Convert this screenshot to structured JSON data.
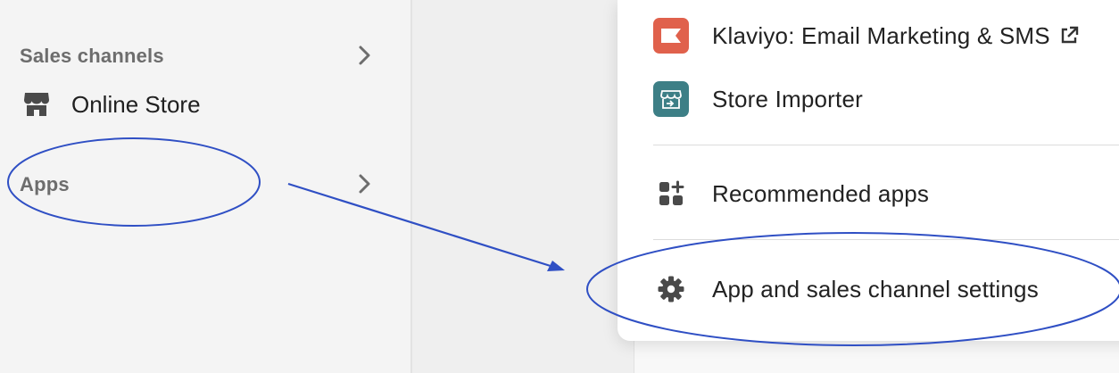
{
  "sidebar": {
    "sales_channels_label": "Sales channels",
    "online_store_label": "Online Store",
    "apps_label": "Apps"
  },
  "popup": {
    "items": [
      {
        "label": "Klaviyo: Email Marketing & SMS",
        "icon": "klaviyo-flag-icon",
        "icon_color": "#e0614c",
        "external": true
      },
      {
        "label": "Store Importer",
        "icon": "store-importer-icon",
        "icon_color": "#3d7f86"
      },
      {
        "label": "Recommended apps",
        "icon": "apps-grid-plus-icon"
      },
      {
        "label": "App and sales channel settings",
        "icon": "gear-icon"
      }
    ]
  },
  "annotation": {
    "color": "#2f4fc4"
  }
}
